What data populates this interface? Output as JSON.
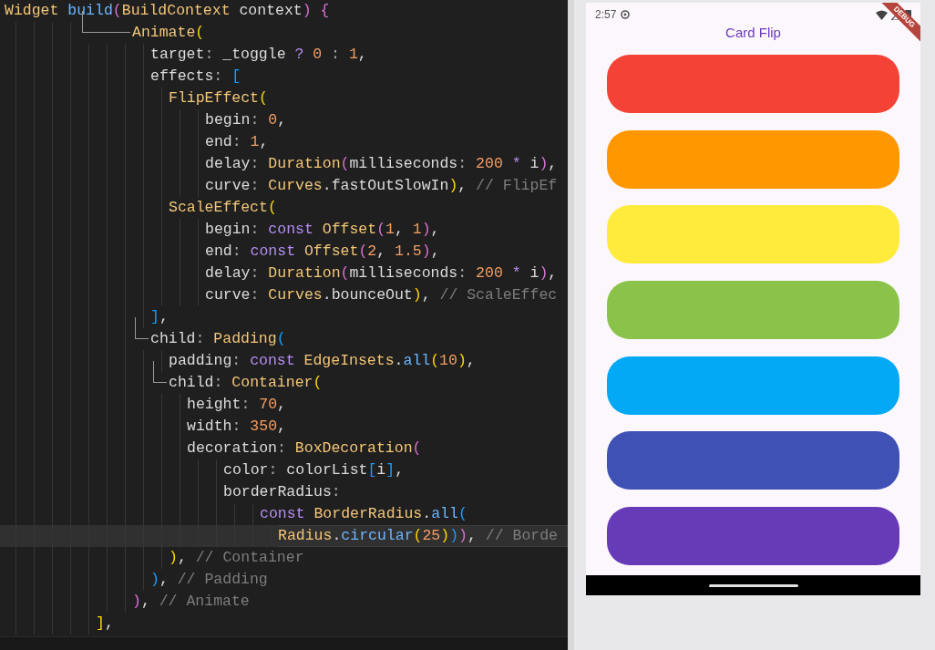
{
  "editor": {
    "lines": [
      {
        "current": false,
        "tokens": [
          {
            "t": "Widget ",
            "kind": "type"
          },
          {
            "t": "build",
            "kind": "func"
          },
          {
            "t": "(",
            "kind": "b2"
          },
          {
            "t": "BuildContext",
            "kind": "type"
          },
          {
            "t": " context",
            "kind": "plain"
          },
          {
            "t": ")",
            "kind": "b2"
          },
          {
            "t": " {",
            "kind": "b2"
          }
        ]
      },
      {
        "current": false,
        "tokens": [
          {
            "t": "Animate",
            "kind": "type"
          },
          {
            "t": "(",
            "kind": "b1"
          }
        ]
      },
      {
        "current": false,
        "tokens": [
          {
            "t": "target",
            "kind": "plain"
          },
          {
            "t": ": ",
            "kind": "op"
          },
          {
            "t": "_toggle ",
            "kind": "plain"
          },
          {
            "t": "? ",
            "kind": "key"
          },
          {
            "t": "0",
            "kind": "num"
          },
          {
            "t": " : ",
            "kind": "op"
          },
          {
            "t": "1",
            "kind": "num"
          },
          {
            "t": ",",
            "kind": "plain"
          }
        ]
      },
      {
        "current": false,
        "tokens": [
          {
            "t": "effects",
            "kind": "plain"
          },
          {
            "t": ": ",
            "kind": "op"
          },
          {
            "t": "[",
            "kind": "b3"
          }
        ]
      },
      {
        "current": false,
        "tokens": [
          {
            "t": "FlipEffect",
            "kind": "type"
          },
          {
            "t": "(",
            "kind": "b1"
          }
        ]
      },
      {
        "current": false,
        "tokens": [
          {
            "t": "begin",
            "kind": "plain"
          },
          {
            "t": ": ",
            "kind": "op"
          },
          {
            "t": "0",
            "kind": "num"
          },
          {
            "t": ",",
            "kind": "plain"
          }
        ]
      },
      {
        "current": false,
        "tokens": [
          {
            "t": "end",
            "kind": "plain"
          },
          {
            "t": ": ",
            "kind": "op"
          },
          {
            "t": "1",
            "kind": "num"
          },
          {
            "t": ",",
            "kind": "plain"
          }
        ]
      },
      {
        "current": false,
        "tokens": [
          {
            "t": "delay",
            "kind": "plain"
          },
          {
            "t": ": ",
            "kind": "op"
          },
          {
            "t": "Duration",
            "kind": "type"
          },
          {
            "t": "(",
            "kind": "b2"
          },
          {
            "t": "milliseconds",
            "kind": "plain"
          },
          {
            "t": ": ",
            "kind": "op"
          },
          {
            "t": "200",
            "kind": "num"
          },
          {
            "t": " * ",
            "kind": "key"
          },
          {
            "t": "i",
            "kind": "plain"
          },
          {
            "t": ")",
            "kind": "b2"
          },
          {
            "t": ",",
            "kind": "plain"
          }
        ]
      },
      {
        "current": false,
        "tokens": [
          {
            "t": "curve",
            "kind": "plain"
          },
          {
            "t": ": ",
            "kind": "op"
          },
          {
            "t": "Curves",
            "kind": "type"
          },
          {
            "t": ".fastOutSlowIn",
            "kind": "plain"
          },
          {
            "t": ")",
            "kind": "b1"
          },
          {
            "t": ", ",
            "kind": "plain"
          },
          {
            "t": "// FlipEf",
            "kind": "comment"
          }
        ]
      },
      {
        "current": false,
        "tokens": [
          {
            "t": "ScaleEffect",
            "kind": "type"
          },
          {
            "t": "(",
            "kind": "b1"
          }
        ]
      },
      {
        "current": false,
        "tokens": [
          {
            "t": "begin",
            "kind": "plain"
          },
          {
            "t": ": ",
            "kind": "op"
          },
          {
            "t": "const ",
            "kind": "key"
          },
          {
            "t": "Offset",
            "kind": "type"
          },
          {
            "t": "(",
            "kind": "b2"
          },
          {
            "t": "1",
            "kind": "num"
          },
          {
            "t": ", ",
            "kind": "plain"
          },
          {
            "t": "1",
            "kind": "num"
          },
          {
            "t": ")",
            "kind": "b2"
          },
          {
            "t": ",",
            "kind": "plain"
          }
        ]
      },
      {
        "current": false,
        "tokens": [
          {
            "t": "end",
            "kind": "plain"
          },
          {
            "t": ": ",
            "kind": "op"
          },
          {
            "t": "const ",
            "kind": "key"
          },
          {
            "t": "Offset",
            "kind": "type"
          },
          {
            "t": "(",
            "kind": "b2"
          },
          {
            "t": "2",
            "kind": "num"
          },
          {
            "t": ", ",
            "kind": "plain"
          },
          {
            "t": "1.5",
            "kind": "num"
          },
          {
            "t": ")",
            "kind": "b2"
          },
          {
            "t": ",",
            "kind": "plain"
          }
        ]
      },
      {
        "current": false,
        "tokens": [
          {
            "t": "delay",
            "kind": "plain"
          },
          {
            "t": ": ",
            "kind": "op"
          },
          {
            "t": "Duration",
            "kind": "type"
          },
          {
            "t": "(",
            "kind": "b2"
          },
          {
            "t": "milliseconds",
            "kind": "plain"
          },
          {
            "t": ": ",
            "kind": "op"
          },
          {
            "t": "200",
            "kind": "num"
          },
          {
            "t": " * ",
            "kind": "key"
          },
          {
            "t": "i",
            "kind": "plain"
          },
          {
            "t": ")",
            "kind": "b2"
          },
          {
            "t": ",",
            "kind": "plain"
          }
        ]
      },
      {
        "current": false,
        "tokens": [
          {
            "t": "curve",
            "kind": "plain"
          },
          {
            "t": ": ",
            "kind": "op"
          },
          {
            "t": "Curves",
            "kind": "type"
          },
          {
            "t": ".bounceOut",
            "kind": "plain"
          },
          {
            "t": ")",
            "kind": "b1"
          },
          {
            "t": ", ",
            "kind": "plain"
          },
          {
            "t": "// ScaleEffec",
            "kind": "comment"
          }
        ]
      },
      {
        "current": false,
        "tokens": [
          {
            "t": "]",
            "kind": "b3"
          },
          {
            "t": ",",
            "kind": "plain"
          }
        ]
      },
      {
        "current": false,
        "tokens": [
          {
            "t": "child",
            "kind": "plain"
          },
          {
            "t": ": ",
            "kind": "op"
          },
          {
            "t": "Padding",
            "kind": "type"
          },
          {
            "t": "(",
            "kind": "b3"
          }
        ]
      },
      {
        "current": false,
        "tokens": [
          {
            "t": "padding",
            "kind": "plain"
          },
          {
            "t": ": ",
            "kind": "op"
          },
          {
            "t": "const ",
            "kind": "key"
          },
          {
            "t": "EdgeInsets",
            "kind": "type"
          },
          {
            "t": ".",
            "kind": "plain"
          },
          {
            "t": "all",
            "kind": "func"
          },
          {
            "t": "(",
            "kind": "b1"
          },
          {
            "t": "10",
            "kind": "num"
          },
          {
            "t": ")",
            "kind": "b1"
          },
          {
            "t": ",",
            "kind": "plain"
          }
        ]
      },
      {
        "current": false,
        "tokens": [
          {
            "t": "child",
            "kind": "plain"
          },
          {
            "t": ": ",
            "kind": "op"
          },
          {
            "t": "Container",
            "kind": "type"
          },
          {
            "t": "(",
            "kind": "b1"
          }
        ]
      },
      {
        "current": false,
        "tokens": [
          {
            "t": "height",
            "kind": "plain"
          },
          {
            "t": ": ",
            "kind": "op"
          },
          {
            "t": "70",
            "kind": "num"
          },
          {
            "t": ",",
            "kind": "plain"
          }
        ]
      },
      {
        "current": false,
        "tokens": [
          {
            "t": "width",
            "kind": "plain"
          },
          {
            "t": ": ",
            "kind": "op"
          },
          {
            "t": "350",
            "kind": "num"
          },
          {
            "t": ",",
            "kind": "plain"
          }
        ]
      },
      {
        "current": false,
        "tokens": [
          {
            "t": "decoration",
            "kind": "plain"
          },
          {
            "t": ": ",
            "kind": "op"
          },
          {
            "t": "BoxDecoration",
            "kind": "type"
          },
          {
            "t": "(",
            "kind": "b2"
          }
        ]
      },
      {
        "current": false,
        "tokens": [
          {
            "t": "color",
            "kind": "plain"
          },
          {
            "t": ": ",
            "kind": "op"
          },
          {
            "t": "colorList",
            "kind": "plain"
          },
          {
            "t": "[",
            "kind": "b3"
          },
          {
            "t": "i",
            "kind": "plain"
          },
          {
            "t": "]",
            "kind": "b3"
          },
          {
            "t": ",",
            "kind": "plain"
          }
        ]
      },
      {
        "current": false,
        "tokens": [
          {
            "t": "borderRadius",
            "kind": "plain"
          },
          {
            "t": ":",
            "kind": "op"
          }
        ]
      },
      {
        "current": false,
        "tokens": [
          {
            "t": "const ",
            "kind": "key"
          },
          {
            "t": "BorderRadius",
            "kind": "type"
          },
          {
            "t": ".",
            "kind": "plain"
          },
          {
            "t": "all",
            "kind": "func"
          },
          {
            "t": "(",
            "kind": "b3"
          }
        ]
      },
      {
        "current": true,
        "tokens": [
          {
            "t": "Radius",
            "kind": "type"
          },
          {
            "t": ".",
            "kind": "plain"
          },
          {
            "t": "circular",
            "kind": "func"
          },
          {
            "t": "(",
            "kind": "b1"
          },
          {
            "t": "25",
            "kind": "num"
          },
          {
            "t": ")",
            "kind": "b1"
          },
          {
            "t": ")",
            "kind": "b3"
          },
          {
            "t": ")",
            "kind": "b2"
          },
          {
            "t": ", ",
            "kind": "plain"
          },
          {
            "t": "// Borde",
            "kind": "comment"
          }
        ]
      },
      {
        "current": false,
        "tokens": [
          {
            "t": ")",
            "kind": "b1"
          },
          {
            "t": ", ",
            "kind": "plain"
          },
          {
            "t": "// Container",
            "kind": "comment"
          }
        ]
      },
      {
        "current": false,
        "tokens": [
          {
            "t": ")",
            "kind": "b3"
          },
          {
            "t": ", ",
            "kind": "plain"
          },
          {
            "t": "// Padding",
            "kind": "comment"
          }
        ]
      },
      {
        "current": false,
        "tokens": [
          {
            "t": ")",
            "kind": "b2"
          },
          {
            "t": ", ",
            "kind": "plain"
          },
          {
            "t": "// Animate",
            "kind": "comment"
          }
        ]
      },
      {
        "current": false,
        "tokens": [
          {
            "t": "]",
            "kind": "b1"
          },
          {
            "t": ",",
            "kind": "plain"
          }
        ]
      }
    ]
  },
  "phone": {
    "time": "2:57",
    "title": "Card Flip",
    "banner": "DEBUG",
    "cards": [
      {
        "color": "#f44336"
      },
      {
        "color": "#ff9800"
      },
      {
        "color": "#ffeb3b"
      },
      {
        "color": "#8bc34a"
      },
      {
        "color": "#03a9f4"
      },
      {
        "color": "#3f51b5"
      },
      {
        "color": "#673ab7"
      }
    ]
  }
}
